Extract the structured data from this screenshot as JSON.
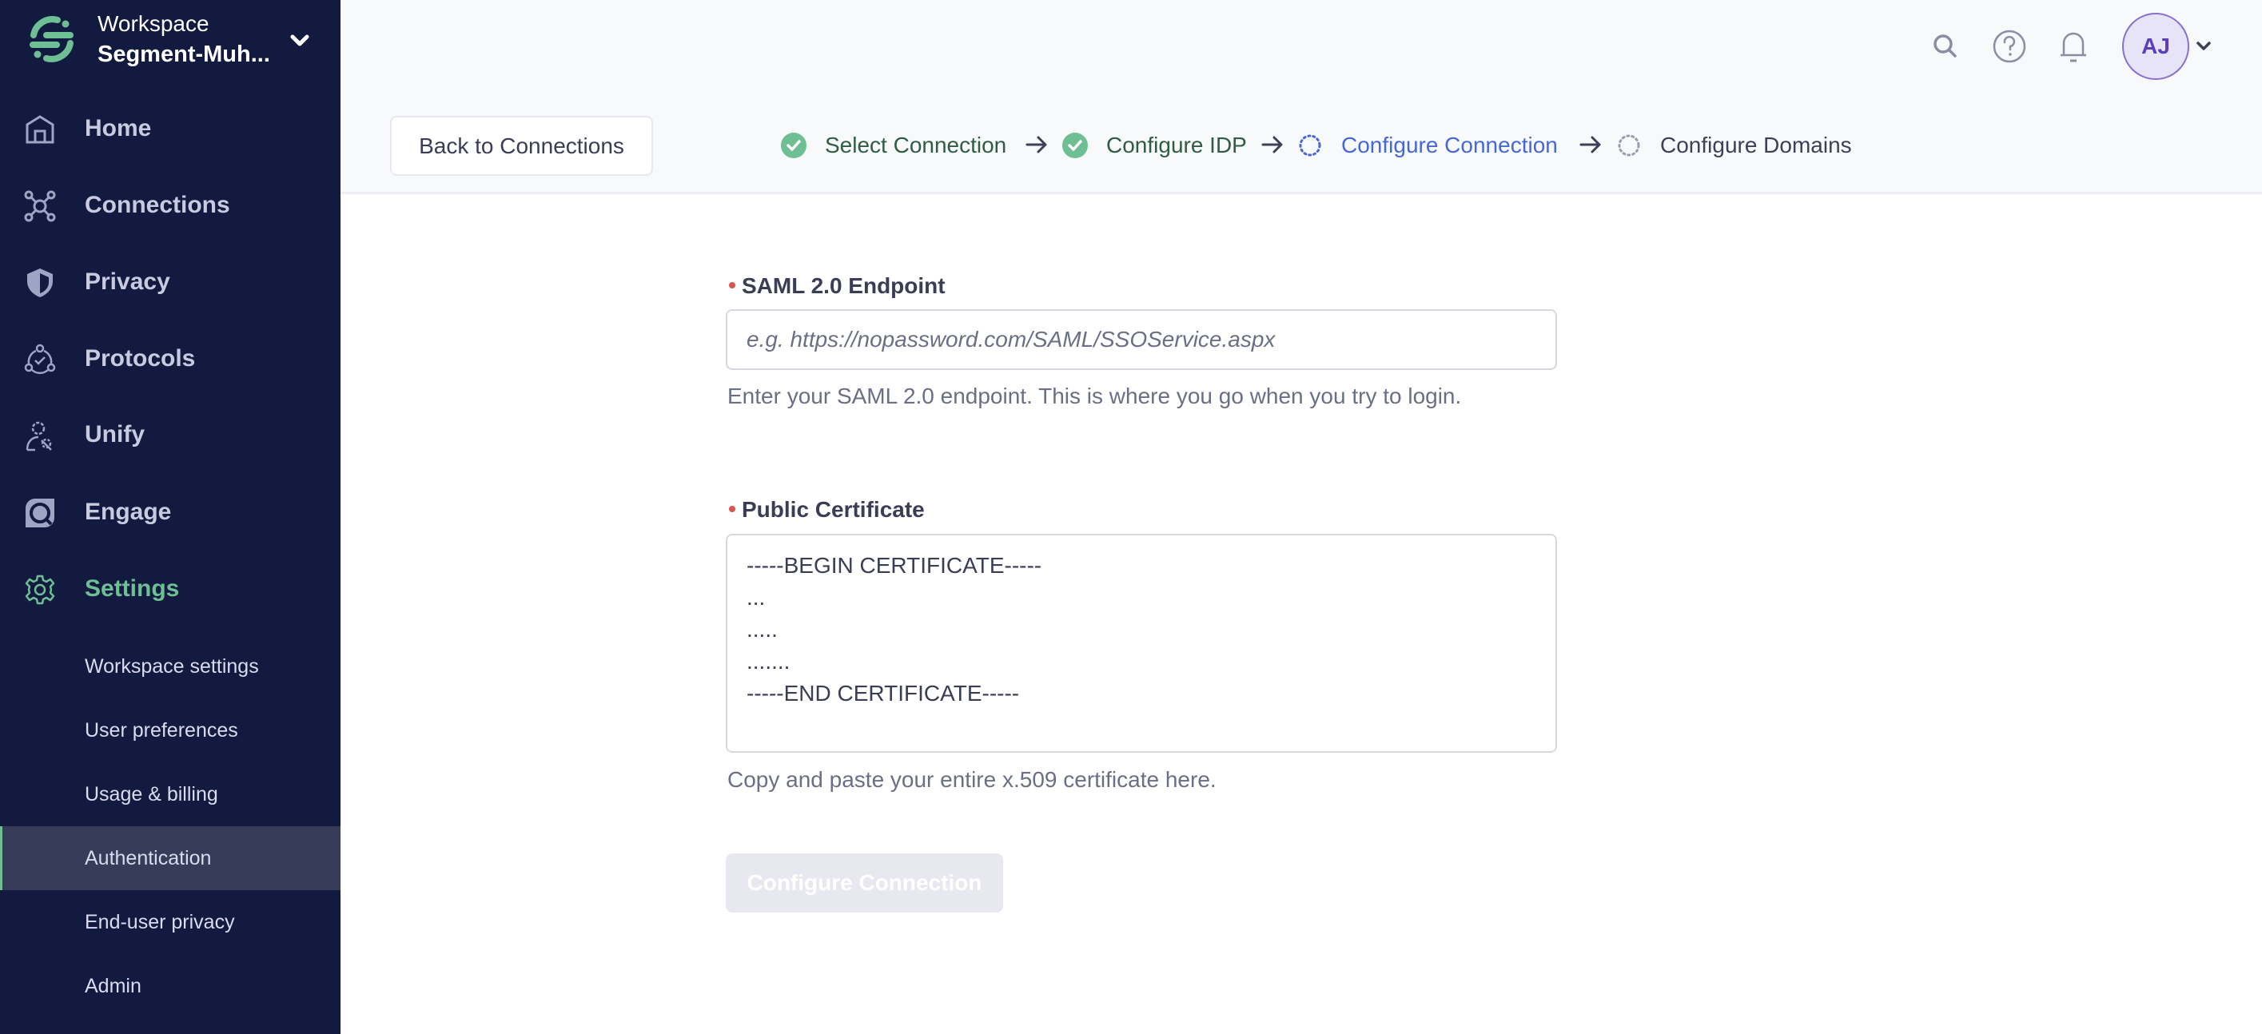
{
  "workspace": {
    "label": "Workspace",
    "name": "Segment-Muh..."
  },
  "sidebar": {
    "items": [
      {
        "label": "Home",
        "icon": "home-icon"
      },
      {
        "label": "Connections",
        "icon": "connections-icon"
      },
      {
        "label": "Privacy",
        "icon": "shield-icon"
      },
      {
        "label": "Protocols",
        "icon": "protocols-icon"
      },
      {
        "label": "Unify",
        "icon": "unify-icon"
      },
      {
        "label": "Engage",
        "icon": "engage-icon"
      },
      {
        "label": "Settings",
        "icon": "gear-icon",
        "active": true
      }
    ],
    "sub_items": [
      {
        "label": "Workspace settings"
      },
      {
        "label": "User preferences"
      },
      {
        "label": "Usage & billing"
      },
      {
        "label": "Authentication",
        "active": true
      },
      {
        "label": "End-user privacy"
      },
      {
        "label": "Admin"
      }
    ]
  },
  "header": {
    "avatar_initials": "AJ",
    "icons": [
      "search-icon",
      "help-icon",
      "bell-icon"
    ]
  },
  "toolbar": {
    "back_label": "Back to Connections"
  },
  "steps": [
    {
      "label": "Select Connection",
      "status": "done"
    },
    {
      "label": "Configure IDP",
      "status": "done"
    },
    {
      "label": "Configure Connection",
      "status": "current"
    },
    {
      "label": "Configure Domains",
      "status": "pending"
    }
  ],
  "form": {
    "endpoint": {
      "label": "SAML 2.0 Endpoint",
      "required": true,
      "value": "",
      "placeholder": "e.g. https://nopassword.com/SAML/SSOService.aspx",
      "help": "Enter your SAML 2.0 endpoint. This is where you go when you try to login."
    },
    "certificate": {
      "label": "Public Certificate",
      "required": true,
      "value": "-----BEGIN CERTIFICATE-----\n...\n.....\n.......\n-----END CERTIFICATE-----",
      "help": "Copy and paste your entire x.509 certificate here."
    },
    "submit_label": "Configure Connection",
    "submit_disabled": true
  },
  "colors": {
    "sidebar_bg": "#121a3f",
    "accent_green": "#6ebf94",
    "current_step_blue": "#4667d6",
    "required_dot": "#d9534f"
  }
}
